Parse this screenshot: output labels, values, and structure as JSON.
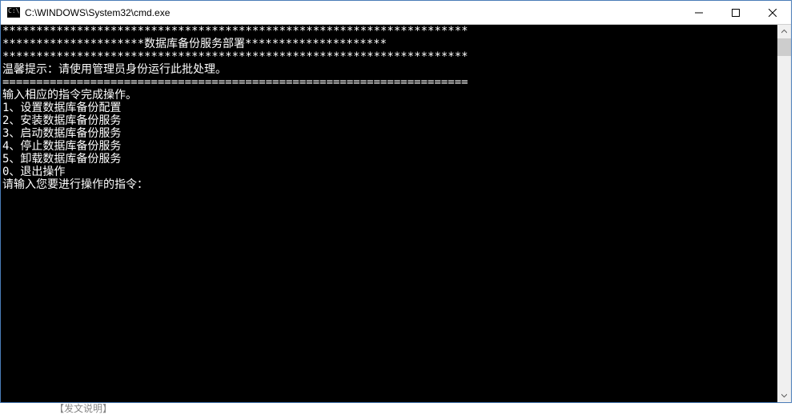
{
  "window": {
    "title": "C:\\WINDOWS\\System32\\cmd.exe",
    "icon_label": "cmd-icon"
  },
  "console": {
    "lines": [
      "*********************************************************************",
      "*********************数据库备份服务部署*********************",
      "*********************************************************************",
      "温馨提示：请使用管理员身份运行此批处理。",
      "=====================================================================",
      "输入相应的指令完成操作。",
      "1、设置数据库备份配置",
      "2、安装数据库备份服务",
      "3、启动数据库备份服务",
      "4、停止数据库备份服务",
      "5、卸载数据库备份服务",
      "0、退出操作",
      "请输入您要进行操作的指令："
    ]
  },
  "controls": {
    "minimize": "minimize",
    "maximize": "maximize",
    "close": "close"
  },
  "background": {
    "tab_text": "【发文说明】"
  }
}
